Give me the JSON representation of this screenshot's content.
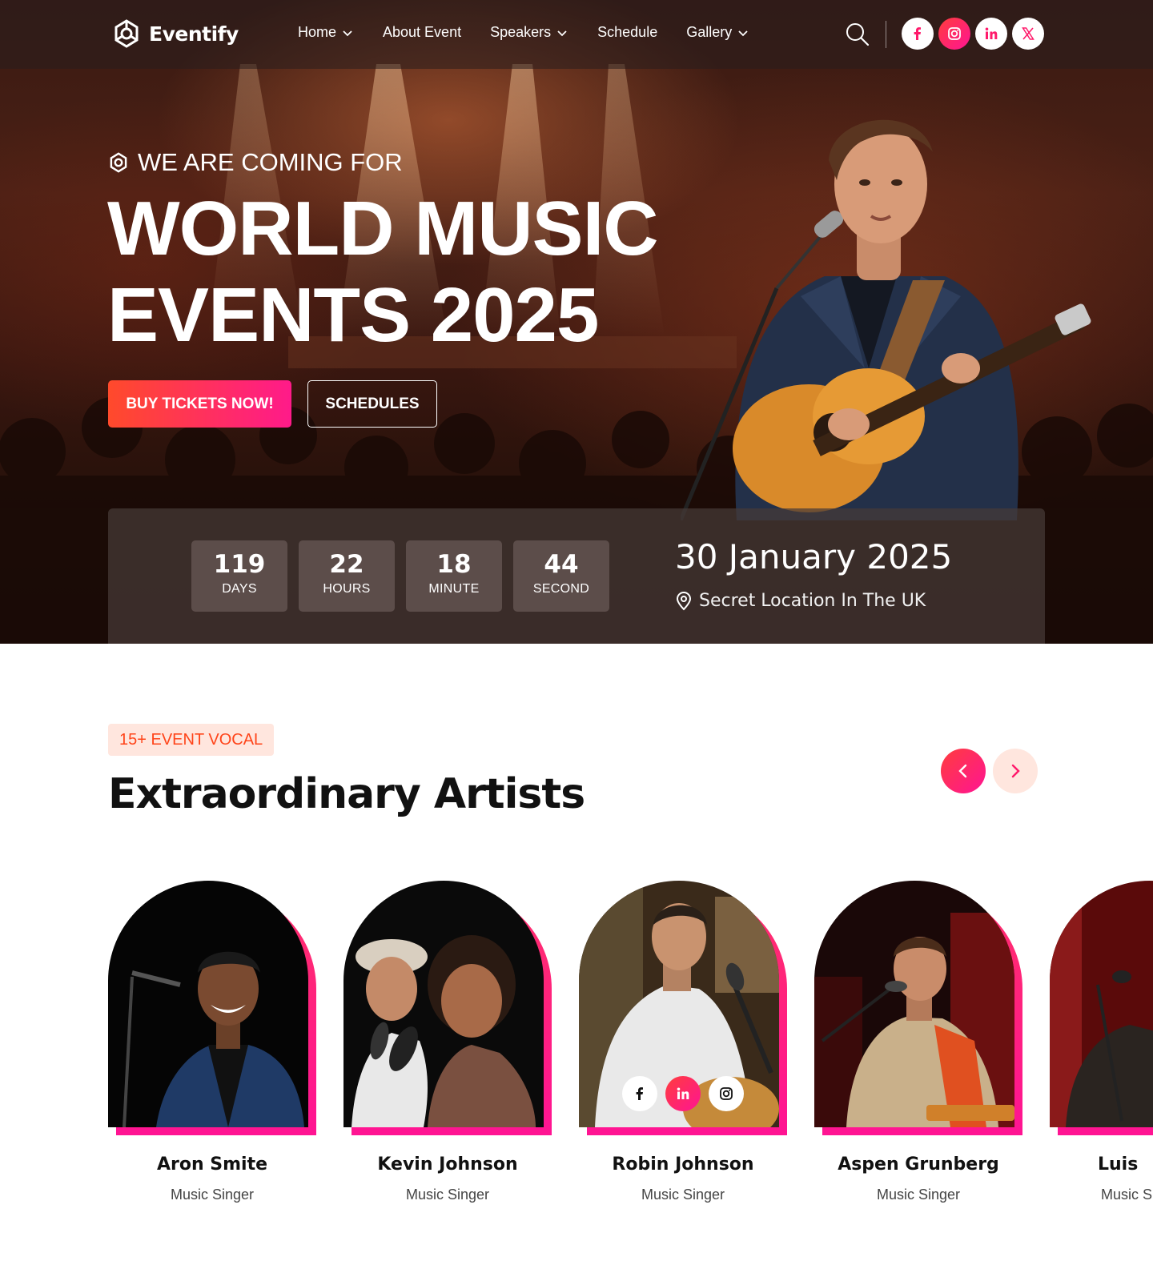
{
  "brand": {
    "name": "Eventify"
  },
  "nav": {
    "items": [
      {
        "label": "Home",
        "has_dropdown": true
      },
      {
        "label": "About Event",
        "has_dropdown": false
      },
      {
        "label": "Speakers",
        "has_dropdown": true
      },
      {
        "label": "Schedule",
        "has_dropdown": false
      },
      {
        "label": "Gallery",
        "has_dropdown": true
      }
    ],
    "socials": [
      "facebook-icon",
      "instagram-icon",
      "linkedin-icon",
      "x-icon"
    ],
    "active_social": "instagram-icon"
  },
  "hero": {
    "kicker": "WE ARE COMING FOR",
    "headline_line1": "WORLD MUSIC",
    "headline_line2": "EVENTS 2025",
    "primary_cta": "BUY TICKETS NOW!",
    "secondary_cta": "SCHEDULES"
  },
  "countdown": {
    "units": [
      {
        "value": "119",
        "label": "DAYS"
      },
      {
        "value": "22",
        "label": "HOURS"
      },
      {
        "value": "18",
        "label": "MINUTE"
      },
      {
        "value": "44",
        "label": "SECOND"
      }
    ],
    "date": "30 January 2025",
    "location": "Secret Location In The UK"
  },
  "artists_section": {
    "tag": "15+ EVENT VOCAL",
    "title": "Extraordinary Artists",
    "artists": [
      {
        "name": "Aron Smite",
        "role": "Music Singer"
      },
      {
        "name": "Kevin Johnson",
        "role": "Music Singer"
      },
      {
        "name": "Robin Johnson",
        "role": "Music Singer"
      },
      {
        "name": "Aspen Grunberg",
        "role": "Music Singer"
      },
      {
        "name": "Luis",
        "role": "Music Singer"
      }
    ]
  },
  "colors": {
    "accent_start": "#ff4a2b",
    "accent_end": "#ff1493",
    "tag_bg": "#ffe6de",
    "tag_text": "#ff4419"
  }
}
